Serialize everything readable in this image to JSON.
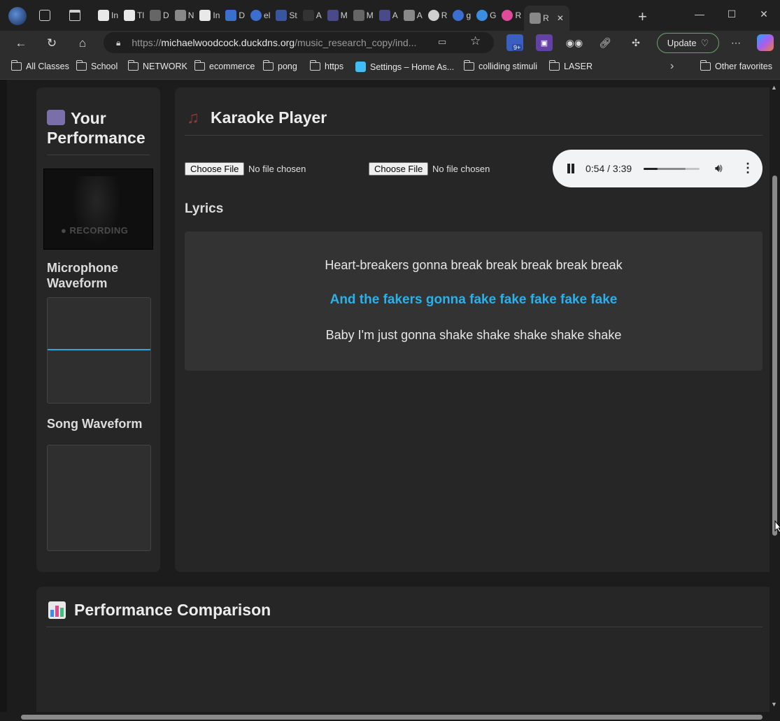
{
  "browser": {
    "tabs": [
      {
        "label": "In",
        "icon": "gmail-icon"
      },
      {
        "label": "Tl",
        "icon": "gmail-icon"
      },
      {
        "label": "D",
        "icon": "github-icon"
      },
      {
        "label": "N",
        "icon": "page-icon"
      },
      {
        "label": "In",
        "icon": "gmail-icon"
      },
      {
        "label": "D",
        "icon": "docs-icon"
      },
      {
        "label": "el",
        "icon": "search-icon"
      },
      {
        "label": "St",
        "icon": "u-icon"
      },
      {
        "label": "A",
        "icon": "mc-icon"
      },
      {
        "label": "M",
        "icon": "arrow-icon"
      },
      {
        "label": "M",
        "icon": "image-icon"
      },
      {
        "label": "A",
        "icon": "arrow-icon"
      },
      {
        "label": "A",
        "icon": "ai-icon"
      },
      {
        "label": "R",
        "icon": "globe-icon"
      },
      {
        "label": "g",
        "icon": "search-icon"
      },
      {
        "label": "G",
        "icon": "gemini-icon"
      },
      {
        "label": "R",
        "icon": "copilot-icon"
      },
      {
        "label": "R",
        "icon": "page-icon"
      }
    ],
    "url_prefix": "https://",
    "url_host": "michaelwoodcock.duckdns.org",
    "url_path": "/music_research_copy/ind...",
    "update_label": "Update",
    "badge_count": "9+",
    "bookmarks": [
      "All Classes",
      "School",
      "NETWORK",
      "ecommerce",
      "pong",
      "https",
      "Settings – Home As...",
      "colliding stimuli",
      "LASER"
    ],
    "other_favorites": "Other favorites"
  },
  "performance": {
    "title": "Your Performance",
    "recording_label": "● RECORDING",
    "mic_heading": "Microphone Waveform",
    "song_heading": "Song Waveform"
  },
  "player": {
    "title": "Karaoke Player",
    "file_button_1": "Choose File",
    "file_status_1": "No file chosen",
    "file_button_2": "Choose File",
    "file_status_2": "No file chosen",
    "audio_time": "0:54 / 3:39",
    "audio_progress": 0.246,
    "audio_buffered": 0.75,
    "lyrics_heading": "Lyrics",
    "lyrics": [
      "Heart-breakers gonna break break break break break",
      "And the fakers gonna fake fake fake fake fake",
      "Baby I'm just gonna shake shake shake shake shake"
    ],
    "active_lyric_index": 1
  },
  "comparison": {
    "title": "Performance Comparison"
  },
  "colors": {
    "accent": "#2bb0e8",
    "panel": "#262626",
    "page": "#1c1c1c"
  }
}
